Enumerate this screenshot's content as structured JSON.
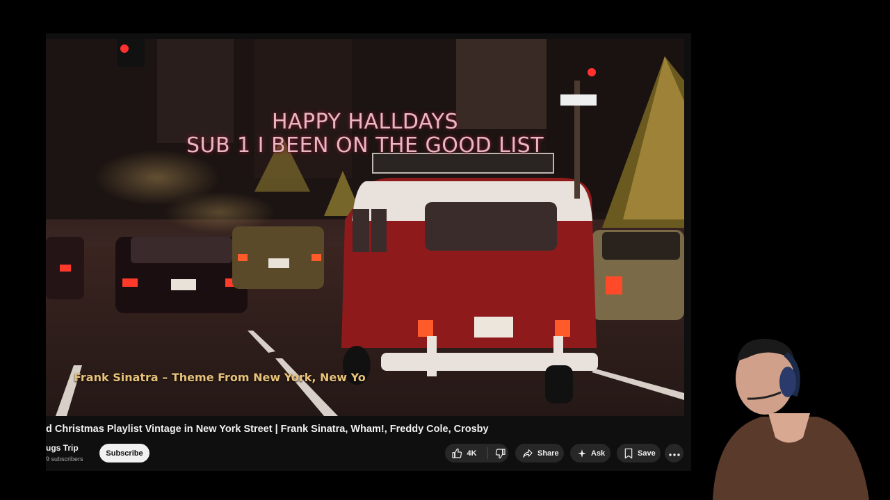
{
  "video": {
    "overlay_line1": "HAPPY HALLDAYS",
    "overlay_line2": "SUB 1 I BEEN ON THE GOOD LIST",
    "caption": "Frank Sinatra –  Theme From New York, New Yo"
  },
  "title": "d Christmas Playlist Vintage in New York Street | Frank Sinatra, Wham!, Freddy Cole, Crosby",
  "channel": {
    "name": "ugs Trip",
    "subscribers": "9 subscribers",
    "subscribe_label": "Subscribe"
  },
  "actions": {
    "like_count": "4K",
    "share_label": "Share",
    "ask_label": "Ask",
    "save_label": "Save"
  },
  "icons": {
    "like": "thumbs-up-icon",
    "dislike": "thumbs-down-icon",
    "share": "share-arrow-icon",
    "ask": "sparkle-icon",
    "save": "bookmark-icon",
    "more": "more-horizontal-icon"
  },
  "colors": {
    "page_background": "#000000",
    "panel_background": "#0f0f0f",
    "pill_background": "#272727",
    "text_primary": "#f1f1f1",
    "text_secondary": "#aaaaaa",
    "overlay_text": "#e6b7c4",
    "caption_text": "#e9c27a",
    "van_red": "#8e1a1c"
  }
}
